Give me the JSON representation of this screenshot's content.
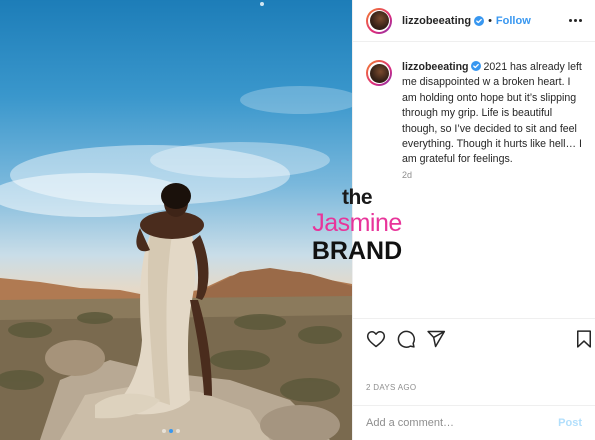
{
  "post": {
    "image_alt": "Woman wrapped in a cream sheet standing on rocks in a desert landscape under a blue sky",
    "watermark": {
      "line1": "the",
      "line2": "Jasmine",
      "line3": "BRAND"
    },
    "carousel": {
      "count": 3,
      "active_index": 1
    }
  },
  "header": {
    "username": "lizzobeeating",
    "separator": "•",
    "follow_label": "Follow",
    "verified": true
  },
  "caption": {
    "username": "lizzobeeating",
    "text": "2021 has already left me disappointed w a broken heart. I am holding onto hope but it’s slipping through my grip. Life is beautiful though, so I’ve decided to sit and feel everything. Though it hurts like hell… I am grateful for feelings.",
    "age": "2d"
  },
  "actions": {
    "icons": [
      "heart-icon",
      "comment-icon",
      "share-icon",
      "bookmark-icon"
    ]
  },
  "footer": {
    "date": "2 DAYS AGO",
    "comment_placeholder": "Add a comment…",
    "post_label": "Post"
  },
  "colors": {
    "accent": "#3897f0",
    "post_disabled": "#b2dffc",
    "muted": "#8e8e8e",
    "watermark_pink": "#e8349a"
  }
}
